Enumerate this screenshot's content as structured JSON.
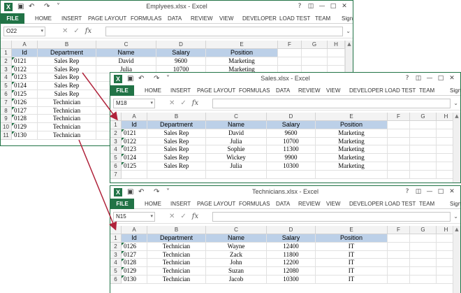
{
  "icons": {
    "excel": "X",
    "save": "▣",
    "undo": "↶",
    "redo": "↷",
    "qat_more": "˅",
    "help": "?",
    "restore": "◫",
    "minimize": "—",
    "maximize": "□",
    "close": "✕",
    "dropdown": "▾",
    "cancel": "✕",
    "enter": "✓",
    "fx": "fx",
    "expand": "⌄",
    "scroll_up": "▲"
  },
  "colors": {
    "excel_green": "#217346",
    "header_fill": "#bcd0e8",
    "arrow": "#b0233b"
  },
  "windows": [
    {
      "title": "Emplyees.xlsx - Excel",
      "name_box": "O22",
      "tabs": [
        "FILE",
        "HOME",
        "INSERT",
        "PAGE LAYOUT",
        "FORMULAS",
        "DATA",
        "REVIEW",
        "VIEW",
        "DEVELOPER",
        "LOAD TEST",
        "TEAM",
        "Sign"
      ],
      "columns": [
        "A",
        "B",
        "C",
        "D",
        "E",
        "F",
        "G",
        "H"
      ],
      "rows": [
        "1",
        "2",
        "3",
        "4",
        "5",
        "6",
        "7",
        "8",
        "9",
        "10",
        "11"
      ],
      "cells": [
        [
          "Id",
          "Department",
          "Name",
          "Salary",
          "Position"
        ],
        [
          "0121",
          "Sales Rep",
          "David",
          "9600",
          "Marketing"
        ],
        [
          "0122",
          "Sales Rep",
          "Julia",
          "10700",
          "Marketing"
        ],
        [
          "0123",
          "Sales Rep",
          "",
          "",
          ""
        ],
        [
          "0124",
          "Sales Rep",
          "",
          "",
          ""
        ],
        [
          "0125",
          "Sales Rep",
          "",
          "",
          ""
        ],
        [
          "0126",
          "Technician",
          "",
          "",
          ""
        ],
        [
          "0127",
          "Technician",
          "",
          "",
          ""
        ],
        [
          "0128",
          "Technician",
          "",
          "",
          ""
        ],
        [
          "0129",
          "Technician",
          "",
          "",
          ""
        ],
        [
          "0130",
          "Technician",
          "",
          "",
          ""
        ]
      ]
    },
    {
      "title": "Sales.xlsx - Excel",
      "name_box": "M18",
      "tabs": [
        "FILE",
        "HOME",
        "INSERT",
        "PAGE LAYOUT",
        "FORMULAS",
        "DATA",
        "REVIEW",
        "VIEW",
        "DEVELOPER",
        "LOAD TEST",
        "TEAM",
        "Sign"
      ],
      "columns": [
        "A",
        "B",
        "C",
        "D",
        "E",
        "F",
        "G",
        "H"
      ],
      "rows": [
        "1",
        "2",
        "3",
        "4",
        "5",
        "6",
        "7"
      ],
      "cells": [
        [
          "Id",
          "Department",
          "Name",
          "Salary",
          "Position"
        ],
        [
          "0121",
          "Sales Rep",
          "David",
          "9600",
          "Marketing"
        ],
        [
          "0122",
          "Sales Rep",
          "Julia",
          "10700",
          "Marketing"
        ],
        [
          "0123",
          "Sales Rep",
          "Sophie",
          "11300",
          "Marketing"
        ],
        [
          "0124",
          "Sales Rep",
          "Wickey",
          "9900",
          "Marketing"
        ],
        [
          "0125",
          "Sales Rep",
          "Julia",
          "10300",
          "Marketing"
        ],
        [
          "",
          "",
          "",
          "",
          ""
        ]
      ]
    },
    {
      "title": "Technicians.xlsx - Excel",
      "name_box": "N15",
      "tabs": [
        "FILE",
        "HOME",
        "INSERT",
        "PAGE LAYOUT",
        "FORMULAS",
        "DATA",
        "REVIEW",
        "VIEW",
        "DEVELOPER",
        "LOAD TEST",
        "TEAM",
        "Sign"
      ],
      "columns": [
        "A",
        "B",
        "C",
        "D",
        "E",
        "F",
        "G",
        "H"
      ],
      "rows": [
        "1",
        "2",
        "3",
        "4",
        "5",
        "6"
      ],
      "cells": [
        [
          "Id",
          "Department",
          "Name",
          "Salary",
          "Position"
        ],
        [
          "0126",
          "Technician",
          "Wayne",
          "12400",
          "IT"
        ],
        [
          "0127",
          "Technician",
          "Zack",
          "11800",
          "IT"
        ],
        [
          "0128",
          "Technician",
          "John",
          "12200",
          "IT"
        ],
        [
          "0129",
          "Technician",
          "Suzan",
          "12080",
          "IT"
        ],
        [
          "0130",
          "Technician",
          "Jacob",
          "10300",
          "IT"
        ]
      ]
    }
  ]
}
